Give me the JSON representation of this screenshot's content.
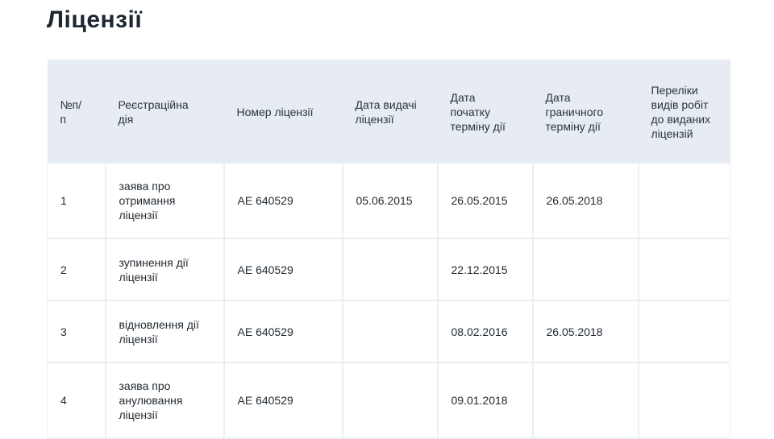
{
  "page": {
    "title": "Ліцензії"
  },
  "table": {
    "headers": [
      "№п/п",
      "Реєстраційна дія",
      "Номер ліцензії",
      "Дата видачі ліцензії",
      "Дата початку терміну дії",
      "Дата граничного терміну дії",
      "Переліки видів робіт до виданих ліцензій"
    ],
    "rows": [
      [
        "1",
        "заява про отримання ліцензії",
        "АЕ 640529",
        "05.06.2015",
        "26.05.2015",
        "26.05.2018",
        ""
      ],
      [
        "2",
        "зупинення дії ліцензії",
        "АЕ 640529",
        "",
        "22.12.2015",
        "",
        ""
      ],
      [
        "3",
        "відновлення дії ліцензії",
        "АЕ 640529",
        "",
        "08.02.2016",
        "26.05.2018",
        ""
      ],
      [
        "4",
        "заява про анулювання ліцензії",
        "АЕ 640529",
        "",
        "09.01.2018",
        "",
        ""
      ]
    ]
  },
  "colors": {
    "header_bg": "#e6ecf1",
    "border": "#eceff2",
    "text": "#1f2a33"
  }
}
